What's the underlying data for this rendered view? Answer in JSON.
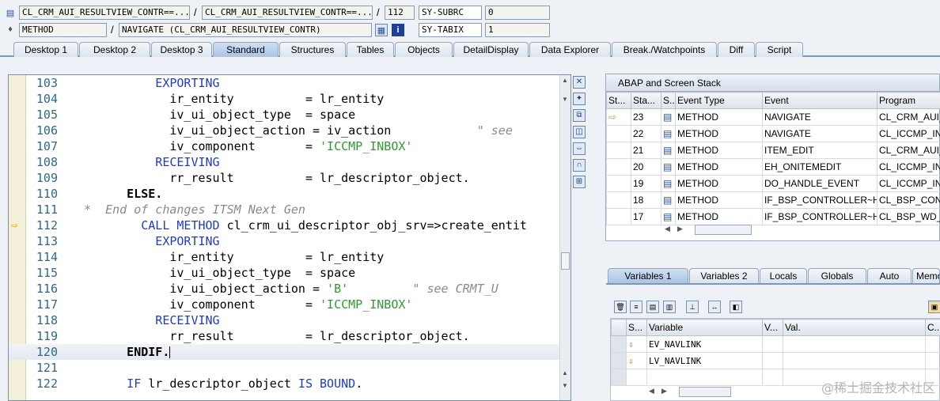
{
  "top": {
    "row1": {
      "program": "CL_CRM_AUI_RESULTVIEW_CONTR==...",
      "include": "CL_CRM_AUI_RESULTVIEW_CONTR==...",
      "line": "112",
      "sysfield": "SY-SUBRC",
      "sysvalue": "0"
    },
    "row2": {
      "type": "METHOD",
      "name": "NAVIGATE (CL_CRM_AUI_RESULTVIEW_CONTR)",
      "sysfield": "SY-TABIX",
      "sysvalue": "1"
    },
    "separator": "/"
  },
  "tabs": [
    "Desktop 1",
    "Desktop 2",
    "Desktop 3",
    "Standard",
    "Structures",
    "Tables",
    "Objects",
    "DetailDisplay",
    "Data Explorer",
    "Break./Watchpoints",
    "Diff",
    "Script"
  ],
  "active_tab": "Standard",
  "code": [
    {
      "n": "103",
      "parts": [
        [
          "kw",
          "          EXPORTING"
        ]
      ]
    },
    {
      "n": "104",
      "parts": [
        [
          "",
          "            ir_entity          = lr_entity"
        ]
      ]
    },
    {
      "n": "105",
      "parts": [
        [
          "",
          "            iv_ui_object_type  = space"
        ]
      ]
    },
    {
      "n": "106",
      "parts": [
        [
          "",
          "            iv_ui_object_action = iv_action"
        ],
        [
          "cmt",
          "            \" see"
        ]
      ]
    },
    {
      "n": "107",
      "parts": [
        [
          "",
          "            iv_component       = "
        ],
        [
          "str",
          "'ICCMP_INBOX'"
        ]
      ]
    },
    {
      "n": "108",
      "parts": [
        [
          "kw",
          "          RECEIVING"
        ]
      ]
    },
    {
      "n": "109",
      "parts": [
        [
          "",
          "            rr_result          = lr_descriptor_object."
        ]
      ]
    },
    {
      "n": "110",
      "parts": [
        [
          "bold",
          "      ELSE."
        ]
      ]
    },
    {
      "n": "111",
      "parts": [
        [
          "cmt",
          "*  End of changes ITSM Next Gen"
        ]
      ]
    },
    {
      "n": "112",
      "parts": [
        [
          "kw",
          "        CALL METHOD"
        ],
        [
          "",
          " cl_crm_ui_descriptor_obj_srv=>create_entit"
        ]
      ]
    },
    {
      "n": "113",
      "parts": [
        [
          "kw",
          "          EXPORTING"
        ]
      ]
    },
    {
      "n": "114",
      "parts": [
        [
          "",
          "            ir_entity          = lr_entity"
        ]
      ]
    },
    {
      "n": "115",
      "parts": [
        [
          "",
          "            iv_ui_object_type  = space"
        ]
      ]
    },
    {
      "n": "116",
      "parts": [
        [
          "",
          "            iv_ui_object_action = "
        ],
        [
          "str",
          "'B'"
        ],
        [
          "cmt",
          "         \" see CRMT_U"
        ]
      ]
    },
    {
      "n": "117",
      "parts": [
        [
          "",
          "            iv_component       = "
        ],
        [
          "str",
          "'ICCMP_INBOX'"
        ]
      ]
    },
    {
      "n": "118",
      "parts": [
        [
          "kw",
          "          RECEIVING"
        ]
      ]
    },
    {
      "n": "119",
      "parts": [
        [
          "",
          "            rr_result          = lr_descriptor_object."
        ]
      ]
    },
    {
      "n": "120",
      "parts": [
        [
          "bold",
          "      ENDIF."
        ]
      ]
    },
    {
      "n": "121",
      "parts": [
        [
          "",
          ""
        ]
      ]
    },
    {
      "n": "122",
      "parts": [
        [
          "kw",
          "      IF"
        ],
        [
          "",
          " lr_descriptor_object "
        ],
        [
          "kw",
          "IS BOUND"
        ],
        [
          "",
          "."
        ]
      ]
    }
  ],
  "stack": {
    "title": "ABAP and Screen Stack",
    "columns": [
      "St...",
      "Sta...",
      "S...",
      "Event Type",
      "Event",
      "Program"
    ],
    "rows": [
      {
        "level": "23",
        "type": "METHOD",
        "event": "NAVIGATE",
        "program": "CL_CRM_AUI_",
        "current": true
      },
      {
        "level": "22",
        "type": "METHOD",
        "event": "NAVIGATE",
        "program": "CL_ICCMP_IN"
      },
      {
        "level": "21",
        "type": "METHOD",
        "event": "ITEM_EDIT",
        "program": "CL_CRM_AUI_"
      },
      {
        "level": "20",
        "type": "METHOD",
        "event": "EH_ONITEMEDIT",
        "program": "CL_ICCMP_IN"
      },
      {
        "level": "19",
        "type": "METHOD",
        "event": "DO_HANDLE_EVENT",
        "program": "CL_ICCMP_IN"
      },
      {
        "level": "18",
        "type": "METHOD",
        "event": "IF_BSP_CONTROLLER~H...",
        "program": "CL_BSP_CONT"
      },
      {
        "level": "17",
        "type": "METHOD",
        "event": "IF_BSP_CONTROLLER~H...",
        "program": "CL_BSP_WD_"
      }
    ]
  },
  "vartabs": [
    "Variables 1",
    "Variables 2",
    "Locals",
    "Globals",
    "Auto",
    "Memor"
  ],
  "vars": {
    "columns": [
      "S...",
      "Variable",
      "V...",
      "Val.",
      "C..."
    ],
    "rows": [
      {
        "name": "EV_NAVLINK",
        "value": ""
      },
      {
        "name": "LV_NAVLINK",
        "value": ""
      }
    ]
  },
  "watermark": "@稀土掘金技术社区"
}
